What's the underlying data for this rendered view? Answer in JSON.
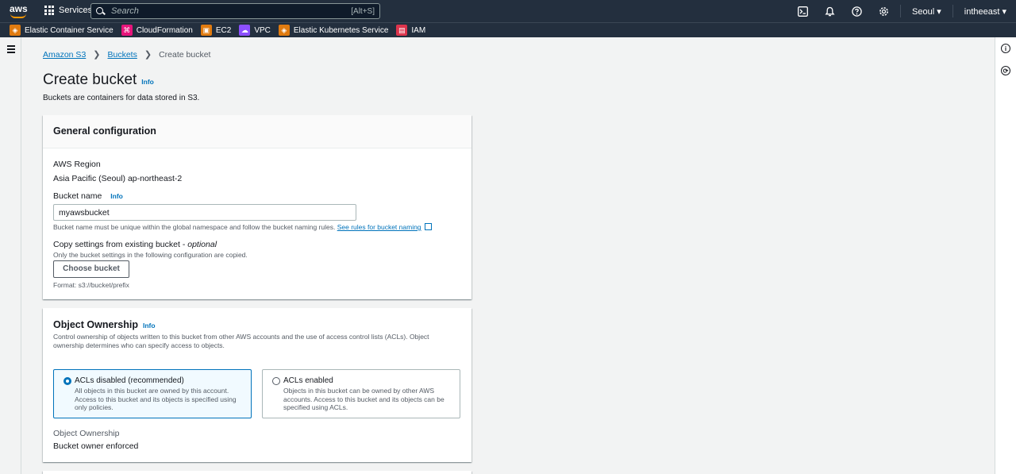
{
  "topnav": {
    "logo_text": "aws",
    "services_label": "Services",
    "search_placeholder": "Search",
    "search_shortcut": "[Alt+S]",
    "region": "Seoul ▾",
    "user": "intheeast ▾"
  },
  "favorites": [
    {
      "label": "Elastic Container Service",
      "color": "#e07b10",
      "glyph": "◈"
    },
    {
      "label": "CloudFormation",
      "color": "#e7157b",
      "glyph": "⌘"
    },
    {
      "label": "EC2",
      "color": "#e07b10",
      "glyph": "▣"
    },
    {
      "label": "VPC",
      "color": "#8c4fff",
      "glyph": "☁"
    },
    {
      "label": "Elastic Kubernetes Service",
      "color": "#e07b10",
      "glyph": "◈"
    },
    {
      "label": "IAM",
      "color": "#dd344c",
      "glyph": "▤"
    }
  ],
  "breadcrumb": {
    "items": [
      "Amazon S3",
      "Buckets"
    ],
    "current": "Create bucket"
  },
  "page": {
    "title": "Create bucket",
    "info": "Info",
    "description": "Buckets are containers for data stored in S3."
  },
  "general": {
    "header": "General configuration",
    "region_label": "AWS Region",
    "region_value": "Asia Pacific (Seoul) ap-northeast-2",
    "bucket_name_label": "Bucket name",
    "bucket_name_info": "Info",
    "bucket_name_value": "myawsbucket",
    "bucket_name_hint": "Bucket name must be unique within the global namespace and follow the bucket naming rules.",
    "bucket_name_link": "See rules for bucket naming",
    "copy_label": "Copy settings from existing bucket - ",
    "copy_optional": "optional",
    "copy_hint": "Only the bucket settings in the following configuration are copied.",
    "choose_button": "Choose bucket",
    "format_hint": "Format: s3://bucket/prefix"
  },
  "ownership": {
    "title": "Object Ownership",
    "info": "Info",
    "description": "Control ownership of objects written to this bucket from other AWS accounts and the use of access control lists (ACLs). Object ownership determines who can specify access to objects.",
    "options": [
      {
        "title": "ACLs disabled (recommended)",
        "desc": "All objects in this bucket are owned by this account. Access to this bucket and its objects is specified using only policies.",
        "selected": true
      },
      {
        "title": "ACLs enabled",
        "desc": "Objects in this bucket can be owned by other AWS accounts. Access to this bucket and its objects can be specified using ACLs.",
        "selected": false
      }
    ],
    "result_label": "Object Ownership",
    "result_value": "Bucket owner enforced"
  }
}
